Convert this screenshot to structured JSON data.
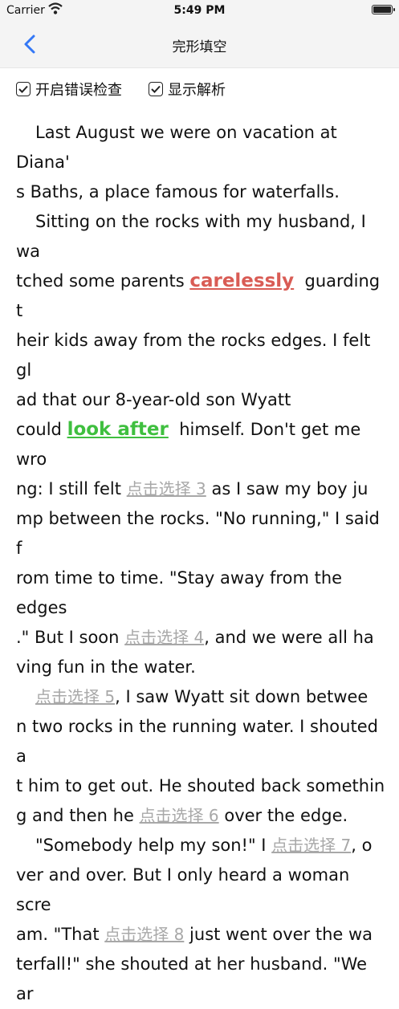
{
  "status_bar": {
    "carrier": "Carrier",
    "time": "5:49 PM"
  },
  "nav": {
    "title": "完形填空",
    "back_icon": "chevron-left-icon"
  },
  "options": [
    {
      "label": "开启错误检查",
      "checked": true
    },
    {
      "label": "显示解析",
      "checked": true
    }
  ],
  "passage": {
    "p1_l1": "Last August we were on vacation at Diana'",
    "p1_l2": "s Baths, a place famous for waterfalls.",
    "p2_l1": "Sitting on the rocks with my husband, I wa",
    "p2_l2a": "tched some parents",
    "ans1": "carelessly",
    "p2_l2b": "guarding t",
    "p2_l3": "heir kids away from the rocks edges. I felt gl",
    "p2_l4": "ad that our 8-year-old son Wyatt",
    "p2_l5a": "could",
    "ans2": "look after",
    "p2_l5b": "himself. Don't get me wro",
    "p2_l6a": "ng: I still felt",
    "blank3": "点击选择 3",
    "p2_l6b": "as I saw my boy ju",
    "p2_l7": "mp between the rocks. \"No running,\" I said f",
    "p2_l8": "rom time to time. \"Stay away from the edges",
    "p2_l9a": ".\" But I soon",
    "blank4": "点击选择 4",
    "p2_l9b": ", and we were all ha",
    "p2_l10": "ving fun in the water.",
    "blank5": "点击选择 5",
    "p3_l1b": ", I saw Wyatt sit down betwee",
    "p3_l2": "n two rocks in the running water. I shouted a",
    "p3_l3": "t him to get out. He shouted back somethin",
    "p3_l4a": "g and then he",
    "blank6": "点击选择 6",
    "p3_l4b": "over the edge.",
    "p4_l1a": "\"Somebody help my son!\" I",
    "blank7": "点击选择 7",
    "p4_l1b": ", o",
    "p4_l2": "ver and over. But I only heard a woman scre",
    "p4_l3a": "am. \"That",
    "blank8": "点击选择 8",
    "p4_l3b": "just went over the wa",
    "p4_l4": "terfall!\" she shouted at her husband. \"We ar"
  },
  "colors": {
    "wrong": "#d95c55",
    "correct": "#3fbf3f",
    "blank": "#a8a8a8"
  }
}
